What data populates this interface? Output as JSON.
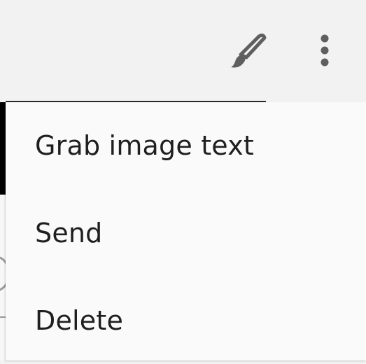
{
  "toolbar": {
    "icons": [
      "paint-brush-icon",
      "more-vert-icon"
    ],
    "icon_color": "#5f5f5f"
  },
  "menu": {
    "items": [
      {
        "label": "Grab image text"
      },
      {
        "label": "Send"
      },
      {
        "label": "Delete"
      }
    ]
  }
}
